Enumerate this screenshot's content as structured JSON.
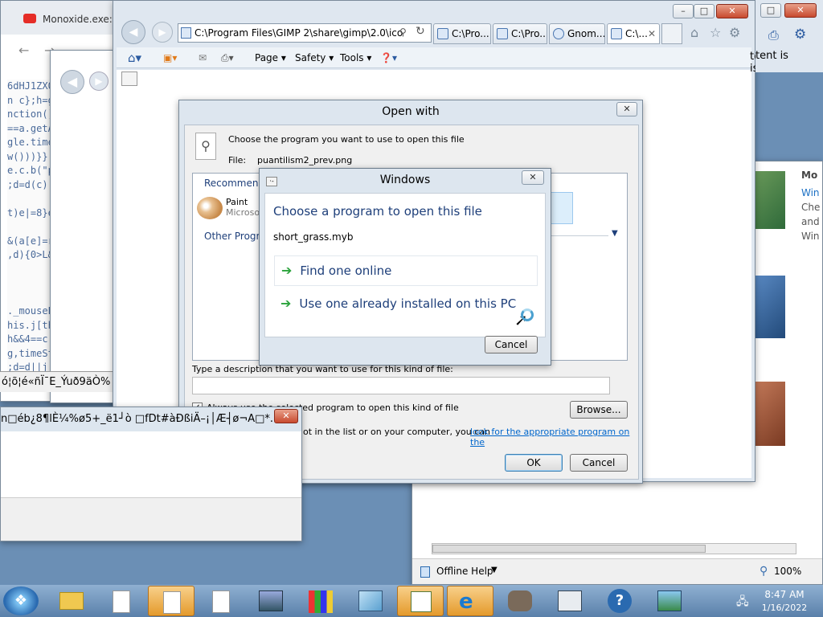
{
  "browser_back": {
    "tab_title": "Monoxide.exe: M",
    "code_lines": [
      "6dHJ1ZX0",
      "",
      "n c};h=g",
      "nction()",
      "==a.getA",
      "gle.time",
      "w()))}}",
      "e.c.b(\"p",
      ";d=d(c);",
      "",
      "t)e|=8}e",
      "",
      "&(a[e]=r",
      ",d){0>L&",
      "",
      "",
      "",
      "",
      "._mouseE",
      "his.j[th",
      "h&&4==c.",
      "g,timeSt",
      ";d=d||j"
    ],
    "garbled_text": "ó¦õ¦é«ñÏ¯E_Ýuð9äÒ%"
  },
  "ie": {
    "address": "C:\\Program Files\\GIMP 2\\share\\gimp\\2.0\\ico",
    "tabs": [
      "C:\\Pro...",
      "C:\\Pro...",
      "Gnom...",
      "C:\\..."
    ],
    "toolbar": {
      "page": "Page",
      "safety": "Safety",
      "tools": "Tools"
    },
    "right_text": "tent is"
  },
  "help_win": {
    "side_heading": "Mo",
    "side_lines": [
      "Win",
      "Che",
      "and",
      "Win"
    ],
    "status": "Offline Help",
    "zoom": "100%"
  },
  "open_with": {
    "title": "Open with",
    "intro": "Choose the program you want to use to open this file",
    "file_label": "File:",
    "file_name": "puantilism2_prev.png",
    "recommended": "Recommended Programs",
    "prog_name": "Paint",
    "prog_sub": "Microsoft",
    "other": "Other Programs",
    "desc_label": "Type a description that you want to use for this kind of file:",
    "always_label": "Always use the selected program to open this kind of file",
    "browse": "Browse...",
    "link_prefix": "ot in the list or on your computer, you can",
    "link_text": "look for the appropriate program on the",
    "ok": "OK",
    "cancel": "Cancel"
  },
  "windows_dlg": {
    "title": "Windows",
    "heading": "Choose a program to open this file",
    "filename": "short_grass.myb",
    "option_online": "Find one online",
    "option_installed": "Use one already installed on this PC",
    "cancel": "Cancel"
  },
  "garbled_win": {
    "title": "n□éb¿8¶lÈ¼%ø5+_ë1┘ò   □fDt#àÐßiÄ–¡│Æ┤ø¬A□*..."
  },
  "taskbar": {
    "time": "8:47 AM",
    "date": "1/16/2022"
  },
  "colors": {
    "link": "#0066cc",
    "heading_blue": "#1e3f7a",
    "arrow_green": "#2ba33c"
  }
}
